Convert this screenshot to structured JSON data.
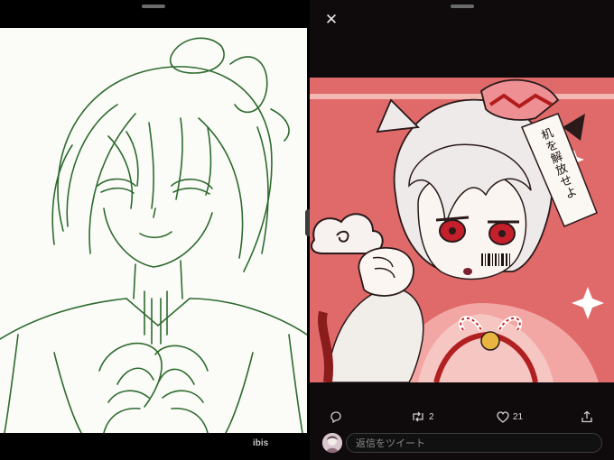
{
  "left": {
    "watermark": "ibis"
  },
  "tweet": {
    "retweet_count": "2",
    "like_count": "21",
    "reply_placeholder": "返信をツイート",
    "talisman_text": "机を解放せよ"
  },
  "colors": {
    "sketch_line": "#2e6b2e",
    "artwork_bg": "#e06a6a",
    "panel_bg": "#0f0a0c"
  }
}
